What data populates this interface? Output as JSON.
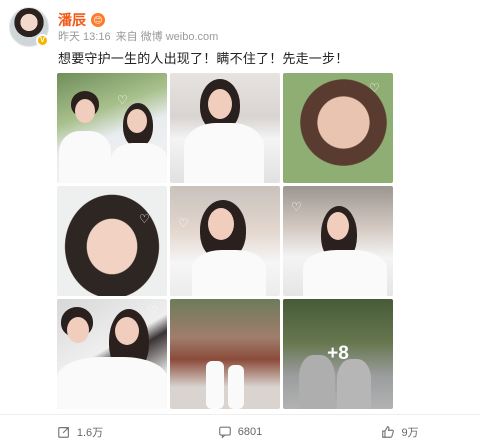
{
  "post": {
    "username": "潘辰",
    "member_badge": "😊",
    "time": "昨天 13:16",
    "source": "来自 微博 weibo.com",
    "text": "想要守护一生的人出现了！瞒不住了！先走一步！"
  },
  "gallery": {
    "more_count": "+8",
    "photos": [
      {
        "alt": "photo-1"
      },
      {
        "alt": "photo-2"
      },
      {
        "alt": "photo-3"
      },
      {
        "alt": "photo-4"
      },
      {
        "alt": "photo-5"
      },
      {
        "alt": "photo-6"
      },
      {
        "alt": "photo-7"
      },
      {
        "alt": "photo-8"
      },
      {
        "alt": "photo-9"
      }
    ]
  },
  "actions": {
    "repost_count": "1.6万",
    "comment_count": "6801",
    "like_count": "9万"
  },
  "colors": {
    "username": "#f25a1a",
    "verified_badge": "#f4b400"
  }
}
